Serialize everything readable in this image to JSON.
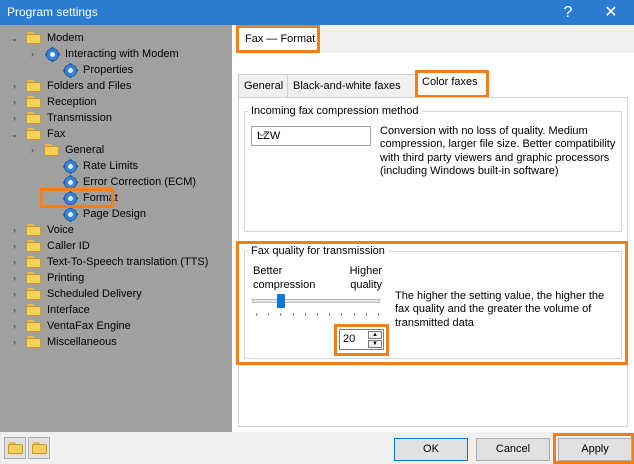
{
  "window": {
    "title": "Program settings",
    "help": "?",
    "close": "✕"
  },
  "tree": [
    {
      "label": "Modem",
      "icon": "folder",
      "expand": "open"
    },
    {
      "label": "Interacting with Modem",
      "icon": "gear",
      "expand": "closed"
    },
    {
      "label": "Properties",
      "icon": "gear",
      "expand": ""
    },
    {
      "label": "Folders and Files",
      "icon": "folder",
      "expand": "closed"
    },
    {
      "label": "Reception",
      "icon": "folder",
      "expand": "closed"
    },
    {
      "label": "Transmission",
      "icon": "folder",
      "expand": "closed"
    },
    {
      "label": "Fax",
      "icon": "folder",
      "expand": "open"
    },
    {
      "label": "General",
      "icon": "folder",
      "expand": "closed"
    },
    {
      "label": "Rate Limits",
      "icon": "gear",
      "expand": ""
    },
    {
      "label": "Error Correction (ECM)",
      "icon": "gear",
      "expand": ""
    },
    {
      "label": "Format",
      "icon": "gear",
      "expand": ""
    },
    {
      "label": "Page Design",
      "icon": "gear",
      "expand": ""
    },
    {
      "label": "Voice",
      "icon": "folder",
      "expand": "closed"
    },
    {
      "label": "Caller ID",
      "icon": "folder",
      "expand": "closed"
    },
    {
      "label": "Text-To-Speech translation (TTS)",
      "icon": "folder",
      "expand": "closed"
    },
    {
      "label": "Printing",
      "icon": "folder",
      "expand": "closed"
    },
    {
      "label": "Scheduled Delivery",
      "icon": "folder",
      "expand": "closed"
    },
    {
      "label": "Interface",
      "icon": "folder",
      "expand": "closed"
    },
    {
      "label": "VentaFax Engine",
      "icon": "folder",
      "expand": "closed"
    },
    {
      "label": "Miscellaneous",
      "icon": "folder",
      "expand": "closed"
    }
  ],
  "breadcrumb": "Fax — Format",
  "tabs": [
    "General",
    "Black-and-white faxes",
    "Color faxes"
  ],
  "compression": {
    "title": "Incoming fax compression method",
    "selected": "LZW",
    "description": "Conversion with no loss of quality. Medium compression, larger file size. Better compatibility with third party viewers and graphic processors (including Windows built-in software)"
  },
  "quality": {
    "title": "Fax quality for transmission",
    "left_label": "Better compression",
    "right_label": "Higher quality",
    "value": "20",
    "slider_fraction": 0.2,
    "description": "The higher the setting value, the higher the fax quality and the greater the volume of transmitted data"
  },
  "buttons": {
    "ok": "OK",
    "cancel": "Cancel",
    "apply": "Apply"
  },
  "colors": {
    "highlight": "#f07f19",
    "titlebar": "#2b7bd0",
    "tree_bg": "#a0a0a0"
  }
}
